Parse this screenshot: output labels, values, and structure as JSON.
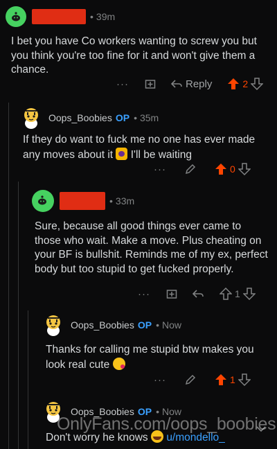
{
  "comments": [
    {
      "user": "",
      "time": "39m",
      "body": "I bet you have Co workers wanting to screw you but you think you're too fine for it and won't give them a chance.",
      "actions": {
        "more": "···",
        "reply": "Reply",
        "score": "2"
      }
    },
    {
      "user": "Oops_Boobies",
      "op": "OP",
      "time": "35m",
      "body_a": "If they do want to fuck me no one has ever made any moves about it",
      "body_b": "I'll be waiting",
      "actions": {
        "more": "···",
        "score": "0"
      }
    },
    {
      "user": "",
      "time": "33m",
      "body": "Sure, because all good things ever came to those who wait. Make a move. Plus cheating on your BF is bullshit. Reminds me of my ex, perfect body but too stupid to get fucked properly.",
      "actions": {
        "more": "···",
        "score": "1"
      }
    },
    {
      "user": "Oops_Boobies",
      "op": "OP",
      "time": "Now",
      "body": "Thanks for calling me stupid btw makes you look real cute",
      "actions": {
        "more": "···",
        "score": "1"
      }
    },
    {
      "user": "Oops_Boobies",
      "op": "OP",
      "time": "Now",
      "body": "Don't worry he knows",
      "mention": "u/mondello_"
    }
  ],
  "separator": "•",
  "watermark": "OnlyFans.com/oops_boobies",
  "colors": {
    "upvote": "#ff4500",
    "op": "#3aa0ff",
    "avatar_green": "#46d160",
    "redaction": "#e02d14"
  }
}
